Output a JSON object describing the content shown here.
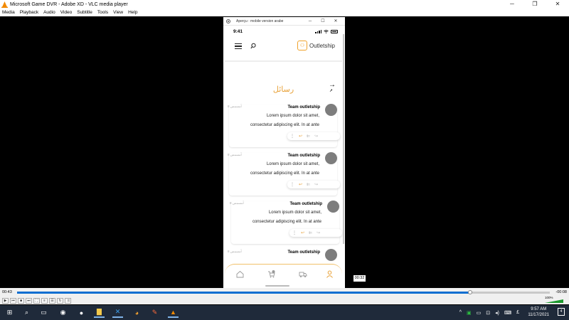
{
  "vlc": {
    "title": "Microsoft Game DVR - Adobe XD - VLC media player",
    "window_controls": [
      "─",
      "❐",
      "✕"
    ],
    "menu": [
      "Media",
      "Playback",
      "Audio",
      "Video",
      "Subtitle",
      "Tools",
      "View",
      "Help"
    ],
    "time_elapsed": "00:43",
    "time_remaining": "-00:08",
    "progress": 0.85,
    "video_timestamp": "00:32",
    "volume": "100%"
  },
  "xd": {
    "window_title": "Aperçu : mobile version arabe",
    "controls": [
      "─",
      "☐",
      "✕"
    ]
  },
  "app": {
    "time": "9:41",
    "logo_name": "Outletship",
    "logo_glyph": "⚇",
    "page_title": "رسائل",
    "back_arrow": "→",
    "messages": [
      {
        "date": "أمسمس 8",
        "sender": "Team outletship",
        "line1": "Lorem ipsum dolor sit amet,",
        "line2": "consectetur adipiscing elit. In at ante"
      },
      {
        "date": "أمسمس 8",
        "sender": "Team outletship",
        "line1": "Lorem ipsum dolor sit amet,",
        "line2": "consectetur adipiscing elit. In at ante"
      },
      {
        "date": "أمسمس 8",
        "sender": "Team outletship",
        "line1": "Lorem ipsum dolor sit amet,",
        "line2": "consectetur adipiscing elit. In at ante"
      },
      {
        "date": "أمسمس 8",
        "sender": "Team outletship",
        "line1": "",
        "line2": ""
      }
    ],
    "tab_icons": [
      "home-icon",
      "cart-icon",
      "truck-icon",
      "user-icon"
    ],
    "accent_color": "#e8a23a"
  },
  "taskbar": {
    "time": "9:57 AM",
    "date": "11/17/2021",
    "notification_count": "4"
  }
}
